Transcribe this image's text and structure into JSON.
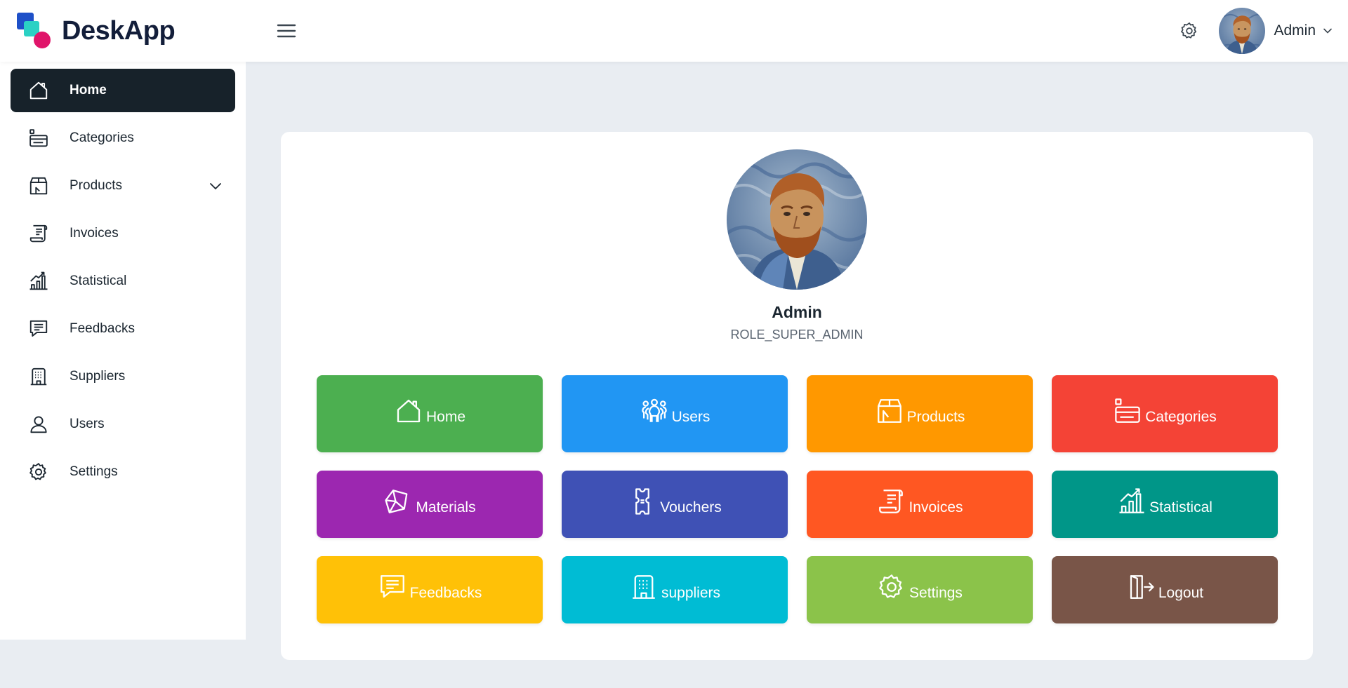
{
  "brand": {
    "name": "DeskApp"
  },
  "header": {
    "username": "Admin"
  },
  "sidebar": {
    "items": [
      {
        "label": "Home",
        "icon": "home-icon"
      },
      {
        "label": "Categories",
        "icon": "categories-icon"
      },
      {
        "label": "Products",
        "icon": "products-icon"
      },
      {
        "label": "Invoices",
        "icon": "invoices-icon"
      },
      {
        "label": "Statistical",
        "icon": "statistical-icon"
      },
      {
        "label": "Feedbacks",
        "icon": "feedbacks-icon"
      },
      {
        "label": "Suppliers",
        "icon": "suppliers-icon"
      },
      {
        "label": "Users",
        "icon": "users-icon"
      },
      {
        "label": "Settings",
        "icon": "settings-icon"
      }
    ],
    "active": "Home"
  },
  "profile": {
    "name": "Admin",
    "role": "ROLE_SUPER_ADMIN"
  },
  "tiles": [
    {
      "label": "Home",
      "icon": "home-icon",
      "color": "#4caf50"
    },
    {
      "label": "Users",
      "icon": "users-icon",
      "color": "#2196f3"
    },
    {
      "label": "Products",
      "icon": "products-icon",
      "color": "#ff9800"
    },
    {
      "label": "Categories",
      "icon": "categories-icon",
      "color": "#f44336"
    },
    {
      "label": "Materials",
      "icon": "cube-icon",
      "color": "#9c27b0"
    },
    {
      "label": "Vouchers",
      "icon": "voucher-icon",
      "color": "#3f51b5"
    },
    {
      "label": "Invoices",
      "icon": "invoices-icon",
      "color": "#ff5722"
    },
    {
      "label": "Statistical",
      "icon": "statistical-icon",
      "color": "#009688"
    },
    {
      "label": "Feedbacks",
      "icon": "feedbacks-icon",
      "color": "#ffc107"
    },
    {
      "label": "suppliers",
      "icon": "suppliers-icon",
      "color": "#00bcd4"
    },
    {
      "label": "Settings",
      "icon": "settings-icon",
      "color": "#8bc34a"
    },
    {
      "label": "Logout",
      "icon": "logout-icon",
      "color": "#795548"
    }
  ],
  "colors": {
    "sidebar_active_bg": "#17222a",
    "page_bg": "#e9edf2"
  }
}
